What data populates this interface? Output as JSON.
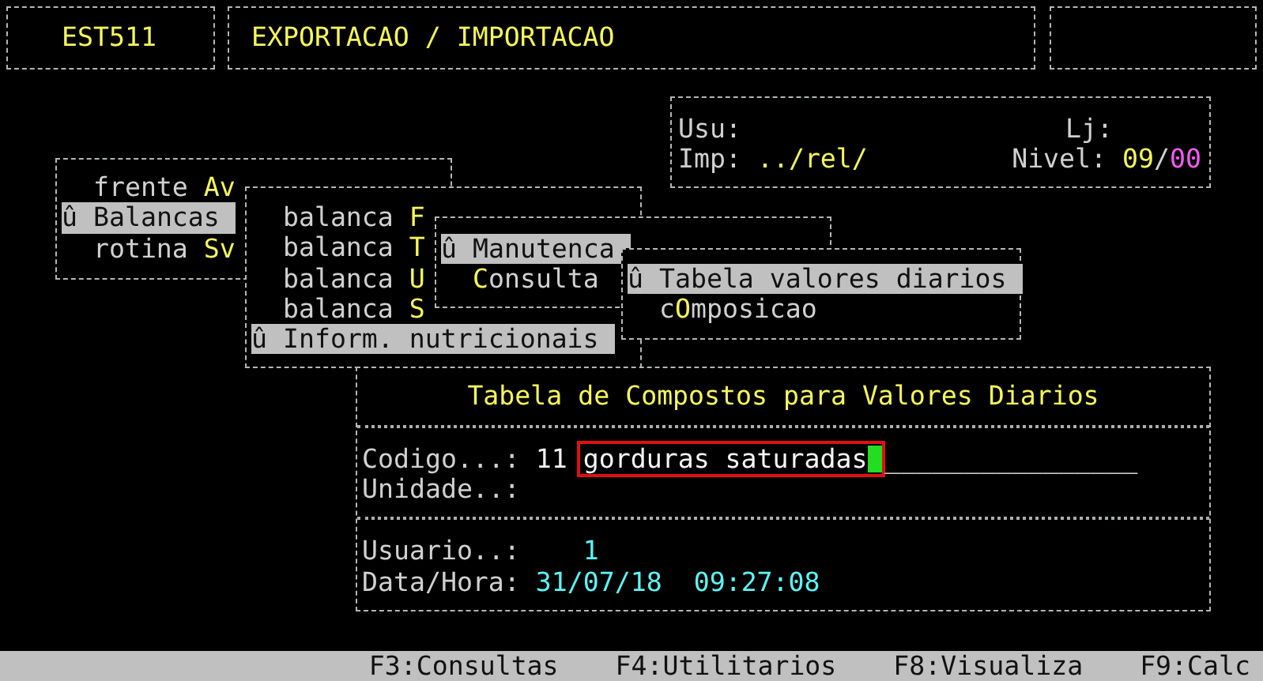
{
  "header": {
    "code": "EST511",
    "title": "EXPORTACAO / IMPORTACAO"
  },
  "session": {
    "usu_label": "Usu:",
    "lj_label": "Lj:",
    "imp_label": "Imp:",
    "imp_value": "../rel/",
    "nivel_label": "Nivel:",
    "nivel_user": "09",
    "nivel_sep": "/",
    "nivel_store": "00"
  },
  "menus": [
    {
      "items": [
        {
          "before": "frente ",
          "hotkey": "Av",
          "selected": false
        },
        {
          "marker": "û",
          "before": "Balancas",
          "selected": true
        },
        {
          "before": "rotina ",
          "hotkey": "Sv",
          "selected": false
        }
      ]
    },
    {
      "items": [
        {
          "before": "balanca ",
          "hotkey": "F",
          "selected": false
        },
        {
          "before": "balanca ",
          "hotkey": "T",
          "selected": false
        },
        {
          "before": "balanca ",
          "hotkey": "U",
          "selected": false
        },
        {
          "before": "balanca ",
          "hotkey": "S",
          "selected": false
        },
        {
          "marker": "û",
          "before": "Inform. nutricionais",
          "selected": true
        }
      ]
    },
    {
      "items": [
        {
          "marker": "û",
          "before": "Manutenca",
          "selected": true
        },
        {
          "hotkey": "C",
          "after": "onsulta",
          "selected": false
        }
      ]
    },
    {
      "items": [
        {
          "marker": "û",
          "before": "Tabela valores diarios",
          "selected": true
        },
        {
          "before": "c",
          "hotkey": "O",
          "after": "mposicao",
          "selected": false
        }
      ]
    }
  ],
  "form": {
    "title": "Tabela de Compostos para Valores Diarios",
    "codigo_label": "Codigo...:",
    "codigo": "11",
    "value": "gorduras saturadas",
    "focused": true,
    "fill": "________________",
    "unidade_label": "Unidade..:",
    "usuario_label": "Usuario..:",
    "usuario": "1",
    "datahora_label": "Data/Hora:",
    "date": "31/07/18",
    "time": "09:27:08"
  },
  "status_bar": [
    "F3:Consultas",
    "F4:Utilitarios",
    "F8:Visualiza",
    "F9:Calc"
  ]
}
